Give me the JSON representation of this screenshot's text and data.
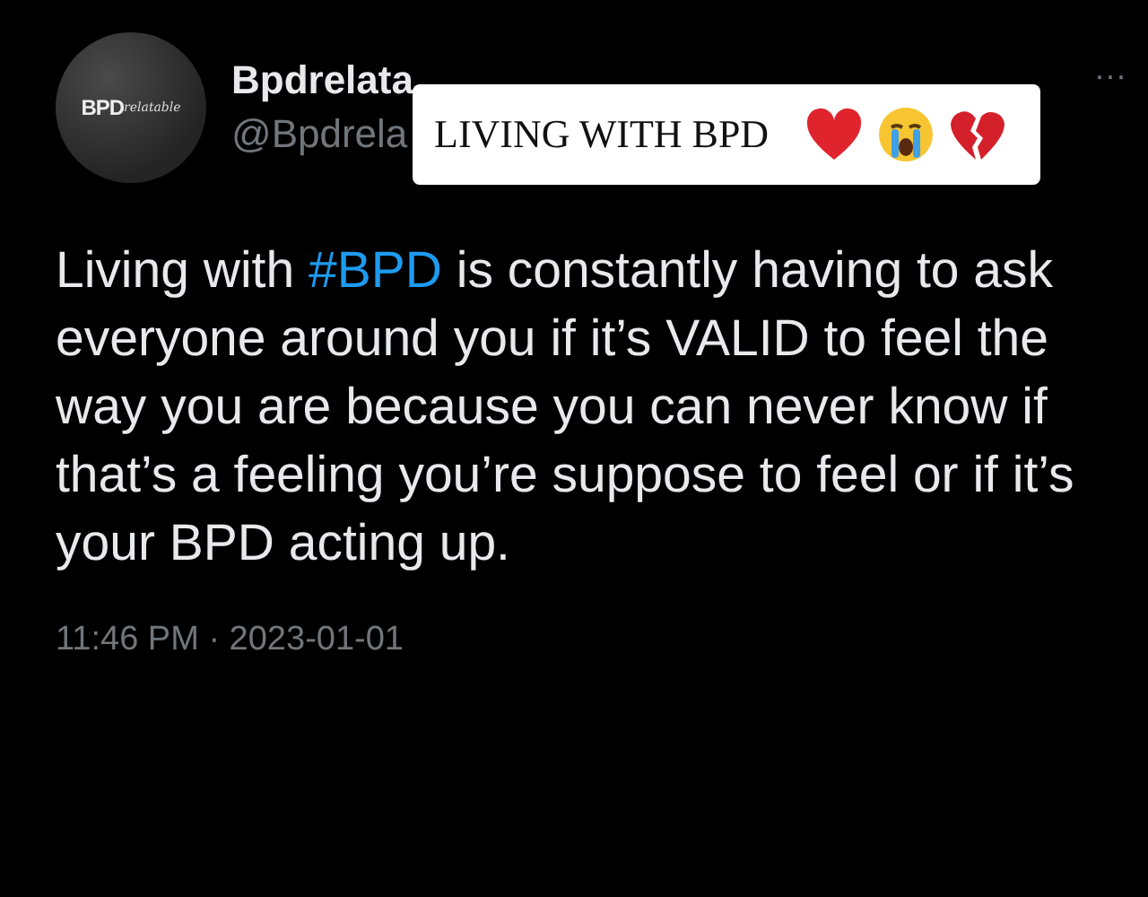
{
  "author": {
    "avatar_text": "BPD",
    "avatar_script": "relatable",
    "name": "Bpdrelata",
    "handle": "@Bpdrela"
  },
  "overlay": {
    "text": "LIVING WITH BPD"
  },
  "more": "···",
  "tweet": {
    "before": "Living with ",
    "hashtag": "#BPD",
    "after": " is constantly having to ask everyone around you if it’s VALID to feel the way you are because you can never know if that’s a feeling you’re suppose to feel or if it’s your BPD acting up."
  },
  "timestamp": "11:46 PM · 2023-01-01"
}
